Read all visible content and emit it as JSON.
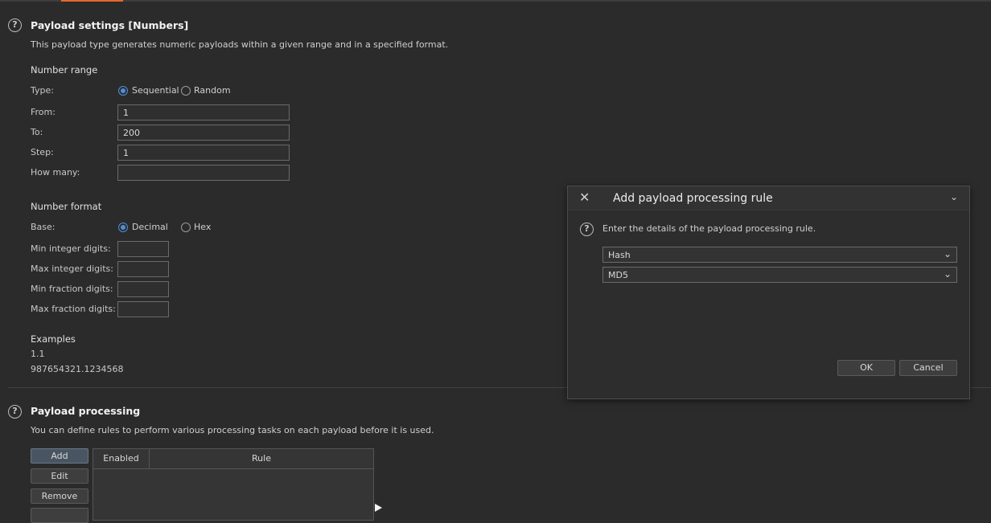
{
  "payload_settings": {
    "title": "Payload settings [Numbers]",
    "description": "This payload type generates numeric payloads within a given range and in a specified format.",
    "number_range": {
      "heading": "Number range",
      "type_label": "Type:",
      "type_options": [
        "Sequential",
        "Random"
      ],
      "type_selected": "Sequential",
      "from_label": "From:",
      "from_value": "1",
      "to_label": "To:",
      "to_value": "200",
      "step_label": "Step:",
      "step_value": "1",
      "how_many_label": "How many:",
      "how_many_value": ""
    },
    "number_format": {
      "heading": "Number format",
      "base_label": "Base:",
      "base_options": [
        "Decimal",
        "Hex"
      ],
      "base_selected": "Decimal",
      "min_int_label": "Min integer digits:",
      "max_int_label": "Max integer digits:",
      "min_frac_label": "Min fraction digits:",
      "max_frac_label": "Max fraction digits:"
    },
    "examples": {
      "heading": "Examples",
      "lines": [
        "1.1",
        "987654321.1234568"
      ]
    }
  },
  "payload_processing": {
    "title": "Payload processing",
    "description": "You can define rules to perform various processing tasks on each payload before it is used.",
    "buttons": {
      "add": "Add",
      "edit": "Edit",
      "remove": "Remove"
    },
    "table_headers": {
      "enabled": "Enabled",
      "rule": "Rule"
    }
  },
  "dialog": {
    "title": "Add payload processing rule",
    "instruction": "Enter the details of the payload processing rule.",
    "rule_type": "Hash",
    "algorithm": "MD5",
    "ok": "OK",
    "cancel": "Cancel",
    "icons": {
      "close": "close-icon",
      "collapse": "chevron-down-icon",
      "help": "help-icon"
    }
  },
  "colors": {
    "accent": "#e8672a",
    "radio_selected": "#4f8fd6",
    "background": "#2b2b2b"
  }
}
